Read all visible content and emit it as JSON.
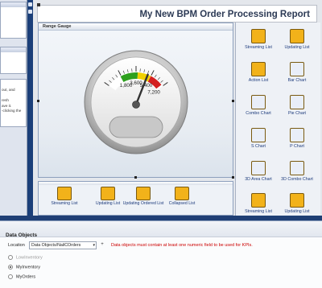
{
  "left_pane": {
    "lines": [
      "out, and",
      "",
      "resh",
      "ave it.",
      "-clicking the"
    ]
  },
  "report": {
    "title": "My New BPM Order Processing Report"
  },
  "gauge": {
    "panel_title": "Range Gauge",
    "scale_labels": [
      "1,800",
      "3,600",
      "5,400",
      "7,200"
    ],
    "colors": {
      "green": "#2ea01e",
      "yellow": "#f0d000",
      "red": "#d42020"
    },
    "needle_value": 5000
  },
  "toolbox": {
    "items": [
      {
        "label": "Streaming List",
        "icon": "streaming-list-icon"
      },
      {
        "label": "Updating List",
        "icon": "updating-list-icon"
      },
      {
        "label": "Action List",
        "icon": "action-list-icon"
      },
      {
        "label": "Bar Chart",
        "icon": "bar-chart-icon"
      },
      {
        "label": "Combo Chart",
        "icon": "combo-chart-icon"
      },
      {
        "label": "Pie Chart",
        "icon": "pie-chart-icon"
      },
      {
        "label": "S Chart",
        "icon": "s-chart-icon"
      },
      {
        "label": "P Chart",
        "icon": "p-chart-icon"
      },
      {
        "label": "3D Area Chart",
        "icon": "area-chart-3d-icon"
      },
      {
        "label": "3D Combo Chart",
        "icon": "combo-chart-3d-icon"
      },
      {
        "label": "Streaming List",
        "icon": "streaming-list-icon"
      },
      {
        "label": "Updating List",
        "icon": "updating-list-icon"
      }
    ]
  },
  "bottom_tools": [
    {
      "label": "Streaming List",
      "icon": "streaming-list-icon"
    },
    {
      "label": "Updating List",
      "icon": "updating-list-icon"
    },
    {
      "label": "Updating Ordered List",
      "icon": "updating-ordered-list-icon"
    },
    {
      "label": "Collapsed List",
      "icon": "collapsed-list-icon"
    }
  ],
  "data_objects": {
    "title": "Data Objects",
    "location_label": "Location",
    "location_value": "Data Objects/NailCOrders",
    "add_glyph": "+",
    "warning": "Data objects must contain at least one numeric field to be used for KPIs.",
    "options": [
      {
        "label": "LowInventory",
        "selected": false,
        "enabled": false
      },
      {
        "label": "MyInventory",
        "selected": true,
        "enabled": true
      },
      {
        "label": "MyOrders",
        "selected": false,
        "enabled": true
      }
    ]
  }
}
